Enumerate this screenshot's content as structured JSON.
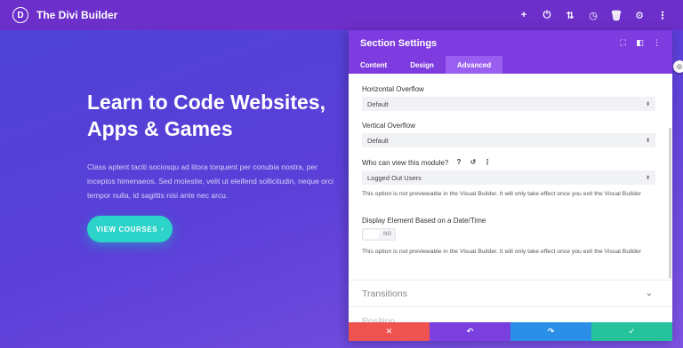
{
  "topbar": {
    "logo_letter": "D",
    "title": "The Divi Builder",
    "icons": [
      {
        "name": "add-icon",
        "glyph": "+"
      },
      {
        "name": "power-icon",
        "glyph": "⏻"
      },
      {
        "name": "sort-icon",
        "glyph": "⇅"
      },
      {
        "name": "history-icon",
        "glyph": "◷"
      },
      {
        "name": "trash-icon",
        "glyph": "🗑"
      },
      {
        "name": "gear-icon",
        "glyph": "⚙"
      },
      {
        "name": "more-icon",
        "glyph": "⋮"
      }
    ]
  },
  "hero": {
    "title": "Learn to Code Websites, Apps & Games",
    "body": "Class aptent taciti sociosqu ad litora torquent per conubia nostra, per inceptos himenaeos. Sed molestie, velit ut eleifend sollicitudin, neque orci tempor nulla, id sagittis nisi ante nec arcu.",
    "cta_label": "VIEW COURSES",
    "cta_arrow": "›"
  },
  "panel": {
    "title": "Section Settings",
    "header_icons": [
      "⛶",
      "◧",
      "⋮"
    ],
    "tabs": [
      "Content",
      "Design",
      "Advanced"
    ],
    "active_tab": "Advanced",
    "horizontal_overflow": {
      "label": "Horizontal Overflow",
      "value": "Default"
    },
    "vertical_overflow": {
      "label": "Vertical Overflow",
      "value": "Default"
    },
    "visibility": {
      "label": "Who can view this module?",
      "icons": [
        "?",
        "↺",
        "⋮"
      ],
      "value": "Logged Out Users",
      "note": "This option is not previewable in the Visual Builder. It will only take effect once you exit the Visual Builder"
    },
    "schedule": {
      "label": "Display Element Based on a Date/Time",
      "toggle_text": "NO",
      "note": "This option is not previewable in the Visual Builder. It will only take effect once you exit the Visual Builder"
    },
    "transitions_label": "Transitions",
    "next_group_label": "Position",
    "footer": {
      "close": "✕",
      "undo": "↶",
      "redo": "↷",
      "save": "✓"
    }
  },
  "colors": {
    "topbar": "#6c2fc9",
    "panel_header": "#7d3be0",
    "cta": "#2bd3c8",
    "close": "#ef5350",
    "redo": "#2b8fe8",
    "save": "#26c29b"
  }
}
